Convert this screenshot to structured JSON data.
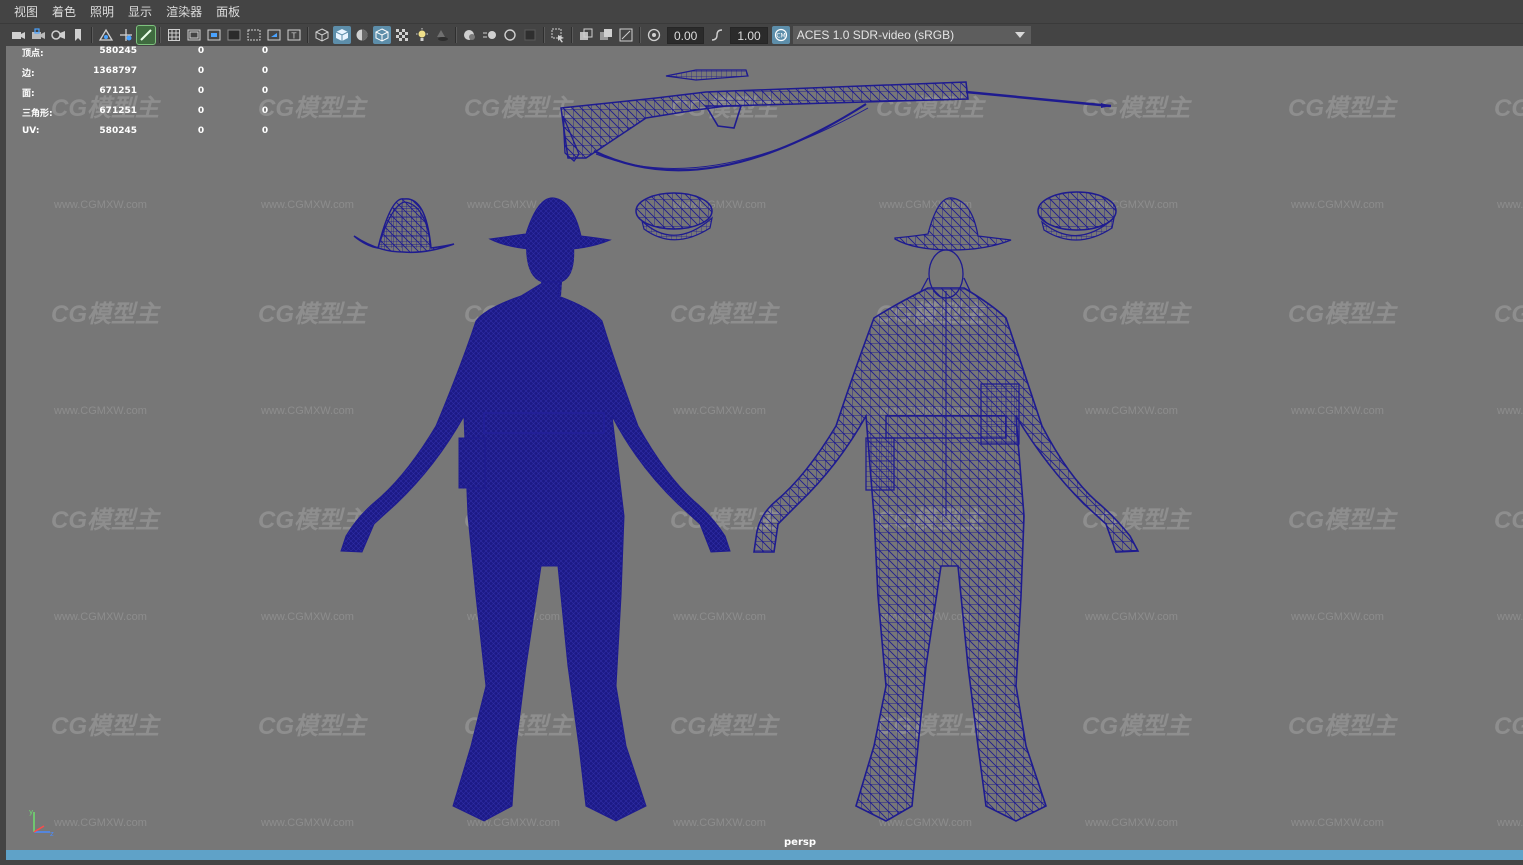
{
  "menu": [
    "视图",
    "着色",
    "照明",
    "显示",
    "渲染器",
    "面板"
  ],
  "toolbar": {
    "field_value_1": "0.00",
    "field_value_2": "1.00",
    "colorspace": "ACES 1.0 SDR-video (sRGB)"
  },
  "hud": [
    {
      "label": "顶点:",
      "v1": "580245",
      "v2": "0",
      "v3": "0"
    },
    {
      "label": "边:",
      "v1": "1368797",
      "v2": "0",
      "v3": "0"
    },
    {
      "label": "面:",
      "v1": "671251",
      "v2": "0",
      "v3": "0"
    },
    {
      "label": "三角形:",
      "v1": "671251",
      "v2": "0",
      "v3": "0"
    },
    {
      "label": "UV:",
      "v1": "580245",
      "v2": "0",
      "v3": "0"
    }
  ],
  "watermark": {
    "logo": "CG模型主",
    "url": "www.CGMXW.com"
  },
  "camera": "persp",
  "axis": {
    "y": "y",
    "z": "z"
  },
  "colors": {
    "wireframe": "#1a1a8a",
    "viewport_bg": "#777777",
    "ui_bg": "#444444",
    "active_blue": "#5d8eaa",
    "status_blue": "#5fa2c8"
  }
}
